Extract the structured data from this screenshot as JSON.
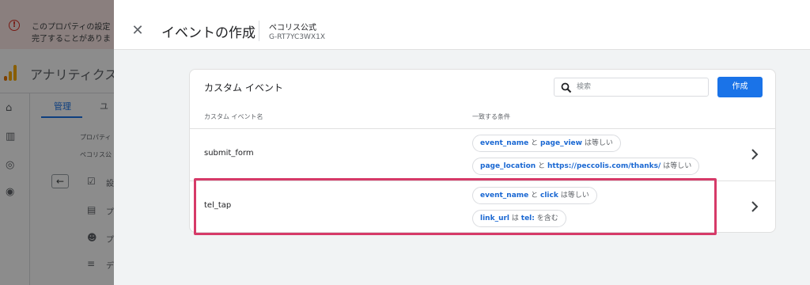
{
  "background": {
    "banner": {
      "line1": "このプロパティの設定",
      "line2": "完了することがありま"
    },
    "app_title": "アナリティクス",
    "tabs": {
      "admin": "管理",
      "user": "ユ"
    },
    "column": {
      "property_label": "プロパティ",
      "property_value": "ペコリス公",
      "items": [
        {
          "label": "設",
          "icon": "checkbox-icon"
        },
        {
          "label": "プ",
          "icon": "layout-icon"
        },
        {
          "label": "プ",
          "icon": "people-icon"
        },
        {
          "label": "デ",
          "icon": "data-icon"
        }
      ]
    }
  },
  "panel": {
    "title": "イベントの作成",
    "property_name": "ペコリス公式",
    "property_id": "G-RT7YC3WX1X"
  },
  "card": {
    "title": "カスタム イベント",
    "search_placeholder": "検索",
    "create_label": "作成",
    "columns": {
      "name": "カスタム イベント名",
      "conditions": "一致する条件"
    },
    "rows": [
      {
        "name": "submit_form",
        "conditions": [
          {
            "key": "event_name",
            "j": "と",
            "val": "page_view",
            "op": "は等しい"
          },
          {
            "key": "page_location",
            "j": "と",
            "val": "https://peccolis.com/thanks/",
            "op": "は等しい"
          }
        ]
      },
      {
        "name": "tel_tap",
        "conditions": [
          {
            "key": "event_name",
            "j": "と",
            "val": "click",
            "op": "は等しい"
          },
          {
            "key": "link_url",
            "j": "は",
            "val": "tel:",
            "op": "を含む"
          }
        ]
      }
    ]
  },
  "colors": {
    "accent": "#1a73e8",
    "highlight": "#d63a68",
    "chip_key": "#1967d2"
  }
}
